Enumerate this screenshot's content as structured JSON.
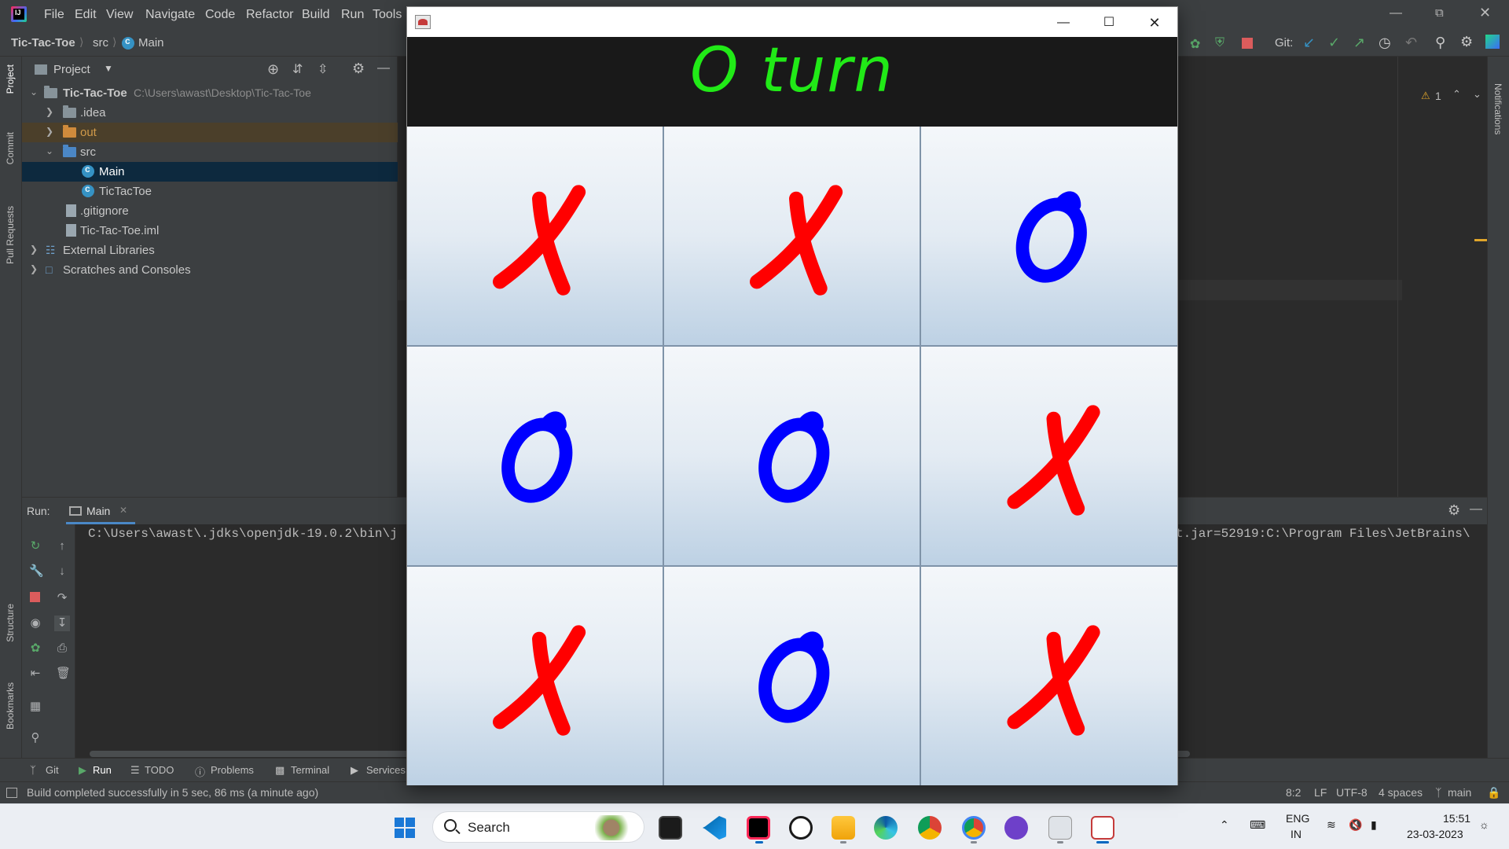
{
  "menu": [
    "File",
    "Edit",
    "View",
    "Navigate",
    "Code",
    "Refactor",
    "Build",
    "Run",
    "Tools"
  ],
  "breadcrumb": {
    "project": "Tic-Tac-Toe",
    "folder": "src",
    "file": "Main"
  },
  "git_label": "Git:",
  "left_tools": [
    "Project",
    "Commit",
    "Pull Requests",
    "Structure",
    "Bookmarks"
  ],
  "right_tools": [
    "Notifications"
  ],
  "project_panel": {
    "title": "Project",
    "tree": [
      {
        "label": "Tic-Tac-Toe",
        "path": "C:\\Users\\awast\\Desktop\\Tic-Tac-Toe"
      },
      {
        "label": ".idea"
      },
      {
        "label": "out"
      },
      {
        "label": "src"
      },
      {
        "label": "Main"
      },
      {
        "label": "TicTacToe"
      },
      {
        "label": ".gitignore"
      },
      {
        "label": "Tic-Tac-Toe.iml"
      },
      {
        "label": "External Libraries"
      },
      {
        "label": "Scratches and Consoles"
      }
    ]
  },
  "editor": {
    "warnings": "1"
  },
  "run_panel": {
    "label": "Run:",
    "tab": "Main",
    "console_left": "C:\\Users\\awast\\.jdks\\openjdk-19.0.2\\bin\\j",
    "console_right": "t.jar=52919:C:\\Program Files\\JetBrains\\"
  },
  "tool_tabs": [
    "Git",
    "Run",
    "TODO",
    "Problems",
    "Terminal",
    "Services"
  ],
  "status": {
    "message": "Build completed successfully in 5 sec, 86 ms (a minute ago)",
    "position": "8:2",
    "line_sep": "LF",
    "encoding": "UTF-8",
    "indent": "4 spaces",
    "branch": "main"
  },
  "game": {
    "status": "O turn",
    "status_color": "#21ea17",
    "x_color": "#ff0000",
    "o_color": "#0000ff",
    "board": [
      "X",
      "X",
      "O",
      "O",
      "O",
      "X",
      "X",
      "O",
      "X"
    ]
  },
  "taskbar": {
    "search": "Search",
    "lang": "ENG",
    "region": "IN",
    "time": "15:51",
    "date": "23-03-2023"
  }
}
